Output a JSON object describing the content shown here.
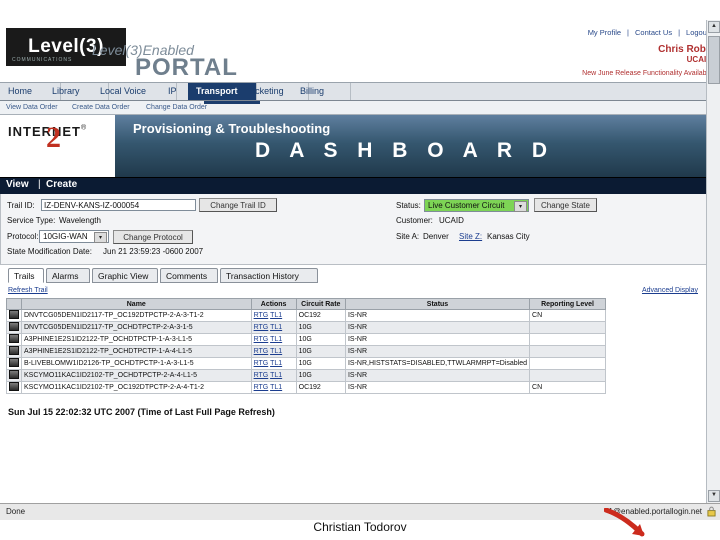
{
  "brand": {
    "logo_main": "Level(3)",
    "logo_sub": "COMMUNICATIONS",
    "enabled_text": "Level(3)Enabled",
    "portal_word": "PORTAL"
  },
  "top_links": [
    "My Profile",
    "Contact Us",
    "Logout"
  ],
  "user": {
    "name": "Chris Robb",
    "customer_id": "UCAID",
    "release_note": "New June Release Functionality Available"
  },
  "nav": {
    "items": [
      {
        "label": "Home",
        "active": false
      },
      {
        "label": "Library",
        "active": false
      },
      {
        "label": "Local Voice",
        "active": false
      },
      {
        "label": "IP",
        "active": false
      },
      {
        "label": "Transport",
        "active": true
      },
      {
        "label": "Ticketing",
        "active": false
      },
      {
        "label": "Billing",
        "active": false
      }
    ],
    "sub_items": [
      "View Data Order",
      "Create Data Order",
      "Change Data Order"
    ]
  },
  "banner": {
    "internet2_word": "INTERNET",
    "internet2_reg": "®",
    "internet2_two": "2",
    "title": "Provisioning & Troubleshooting",
    "dashboard": "D A S H B O A R D"
  },
  "view_create": {
    "view": "View",
    "separator": "|",
    "create": "Create"
  },
  "form": {
    "trail_id_label": "Trail ID:",
    "trail_id_value": "IZ-DENV-KANS-IZ-000054",
    "change_trail_id_button": "Change Trail ID",
    "service_type_label": "Service Type:",
    "service_type_value": "Wavelength",
    "protocol_label": "Protocol:",
    "protocol_value": "10GIG-WAN",
    "change_protocol_button": "Change Protocol",
    "state_mod_label": "State Modification Date:",
    "state_mod_value": "Jun 21 23:59:23 -0600 2007",
    "status_label": "Status:",
    "status_value": "Live Customer Circuit",
    "change_state_button": "Change State",
    "customer_label": "Customer:",
    "customer_value": "UCAID",
    "site_a_label": "Site A:",
    "site_a_value": "Denver",
    "site_z_label": "Site Z:",
    "site_z_value": "Kansas City"
  },
  "tabs": [
    {
      "label": "Trails",
      "active": true
    },
    {
      "label": "Alarms",
      "active": false
    },
    {
      "label": "Graphic View",
      "active": false
    },
    {
      "label": "Comments",
      "active": false
    },
    {
      "label": "Transaction History",
      "active": false
    }
  ],
  "table_controls": {
    "refresh_link": "Refresh Trail",
    "advanced_link": "Advanced Display"
  },
  "table": {
    "columns": [
      "",
      "Name",
      "Actions",
      "Circuit Rate",
      "Status",
      "Reporting Level"
    ],
    "rows": [
      {
        "name": "DNVTCG05DEN1ID2117-TP_OC192DTPCTP-2-A-3-T1-2",
        "action_rtg": "RTG",
        "action_tl": "TL1",
        "rate": "OC192",
        "status": "IS-NR",
        "reporting": "CN"
      },
      {
        "name": "DNVTCG05DEN1ID2117-TP_OCHDTPCTP-2-A-3-1-5",
        "action_rtg": "RTG",
        "action_tl": "TL1",
        "rate": "10G",
        "status": "IS-NR",
        "reporting": ""
      },
      {
        "name": "A3PHINE1E2S1ID2122-TP_OCHDTPCTP-1-A-3-L1-5",
        "action_rtg": "RTG",
        "action_tl": "TL1",
        "rate": "10G",
        "status": "IS-NR",
        "reporting": ""
      },
      {
        "name": "A3PHINE1E2S1ID2122-TP_OCHDTPCTP-1-A-4-L1-5",
        "action_rtg": "RTG",
        "action_tl": "TL1",
        "rate": "10G",
        "status": "IS-NR",
        "reporting": ""
      },
      {
        "name": "B-LIVEBLOMW1ID2126-TP_OCHDTPCTP-1-A-3-L1-5",
        "action_rtg": "RTG",
        "action_tl": "TL1",
        "rate": "10G",
        "status": "IS-NR,HISTSTATS=DISABLED,TTWLARMRPT=Disabled",
        "reporting": ""
      },
      {
        "name": "KSCYMO11KAC1ID2102-TP_OCHDTPCTP-2-A-4-L1-5",
        "action_rtg": "RTG",
        "action_tl": "TL1",
        "rate": "10G",
        "status": "IS-NR",
        "reporting": ""
      },
      {
        "name": "KSCYMO11KAC1ID2102-TP_OC192DTPCTP-2-A-4-T1-2",
        "action_rtg": "RTG",
        "action_tl": "TL1",
        "rate": "OC192",
        "status": "IS-NR",
        "reporting": "CN"
      }
    ]
  },
  "footer_note": "Sun Jul 15 22:02:32 UTC 2007 (Time of Last Full Page Refresh)",
  "status_bar": {
    "left": "Done",
    "zone": "1@enabled.portallogin.net"
  },
  "caption": "Christian Todorov",
  "colors": {
    "nav_active": "#1b3d6d",
    "status_green": "#7dd455",
    "link_blue": "#1b3d8f",
    "accent_red": "#b03030"
  }
}
